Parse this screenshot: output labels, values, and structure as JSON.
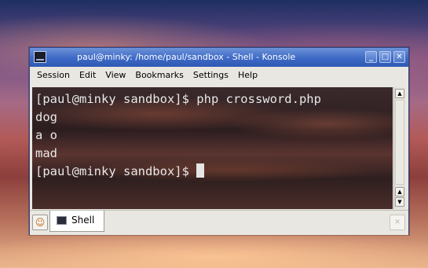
{
  "window": {
    "title": "paul@minky: /home/paul/sandbox - Shell - Konsole",
    "buttons": {
      "minimize": "_",
      "maximize": "□",
      "close": "✕"
    }
  },
  "menubar": {
    "items": [
      "Session",
      "Edit",
      "View",
      "Bookmarks",
      "Settings",
      "Help"
    ]
  },
  "terminal": {
    "lines": [
      "[paul@minky sandbox]$ php crossword.php",
      "dog",
      "a o",
      "mad",
      "[paul@minky sandbox]$ "
    ]
  },
  "tabs": [
    {
      "label": "Shell",
      "icon": "terminal-icon",
      "active": true
    }
  ],
  "colors": {
    "titlebar": "#3d6ac6",
    "terminal_text": "#e8e8e8",
    "window_bg": "#e9e7e2"
  }
}
